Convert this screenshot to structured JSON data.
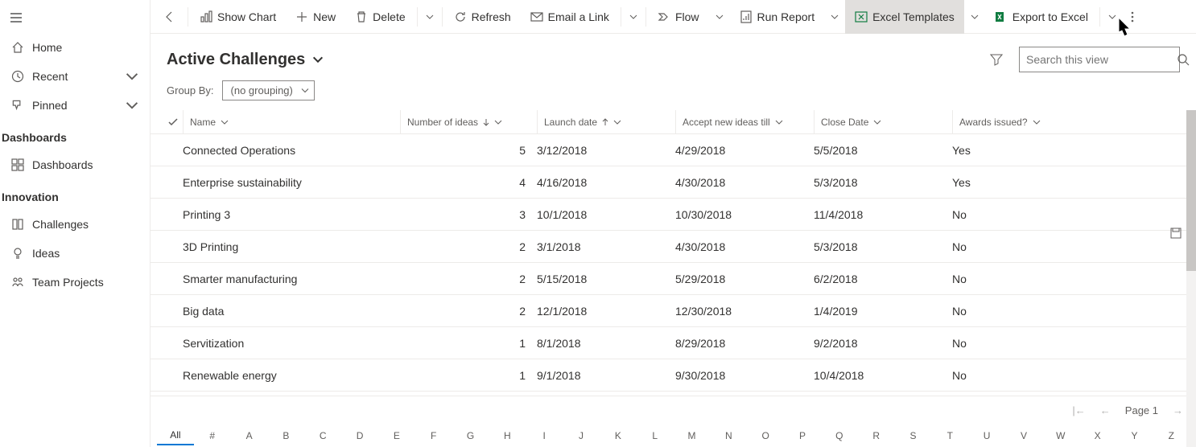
{
  "sidebar": {
    "home": "Home",
    "recent": "Recent",
    "pinned": "Pinned",
    "section_dashboards": "Dashboards",
    "item_dashboards": "Dashboards",
    "section_innovation": "Innovation",
    "item_challenges": "Challenges",
    "item_ideas": "Ideas",
    "item_teamprojects": "Team Projects"
  },
  "toolbar": {
    "show_chart": "Show Chart",
    "new": "New",
    "delete": "Delete",
    "refresh": "Refresh",
    "email_link": "Email a Link",
    "flow": "Flow",
    "run_report": "Run Report",
    "excel_templates": "Excel Templates",
    "export_excel": "Export to Excel"
  },
  "view": {
    "title": "Active Challenges",
    "groupby_label": "Group By:",
    "groupby_value": "(no grouping)",
    "search_placeholder": "Search this view"
  },
  "columns": {
    "name": "Name",
    "number_of_ideas": "Number of ideas",
    "launch_date": "Launch date",
    "accept_until": "Accept new ideas till",
    "close_date": "Close Date",
    "awards": "Awards issued?"
  },
  "rows": [
    {
      "name": "Connected Operations",
      "num": "5",
      "launch": "3/12/2018",
      "accept": "4/29/2018",
      "close": "5/5/2018",
      "awards": "Yes"
    },
    {
      "name": "Enterprise sustainability",
      "num": "4",
      "launch": "4/16/2018",
      "accept": "4/30/2018",
      "close": "5/3/2018",
      "awards": "Yes"
    },
    {
      "name": "Printing 3",
      "num": "3",
      "launch": "10/1/2018",
      "accept": "10/30/2018",
      "close": "11/4/2018",
      "awards": "No"
    },
    {
      "name": "3D Printing",
      "num": "2",
      "launch": "3/1/2018",
      "accept": "4/30/2018",
      "close": "5/3/2018",
      "awards": "No"
    },
    {
      "name": "Smarter manufacturing",
      "num": "2",
      "launch": "5/15/2018",
      "accept": "5/29/2018",
      "close": "6/2/2018",
      "awards": "No"
    },
    {
      "name": "Big data",
      "num": "2",
      "launch": "12/1/2018",
      "accept": "12/30/2018",
      "close": "1/4/2019",
      "awards": "No"
    },
    {
      "name": "Servitization",
      "num": "1",
      "launch": "8/1/2018",
      "accept": "8/29/2018",
      "close": "9/2/2018",
      "awards": "No"
    },
    {
      "name": "Renewable energy",
      "num": "1",
      "launch": "9/1/2018",
      "accept": "9/30/2018",
      "close": "10/4/2018",
      "awards": "No"
    }
  ],
  "footer": {
    "page_label": "Page 1"
  },
  "alpha": [
    "All",
    "#",
    "A",
    "B",
    "C",
    "D",
    "E",
    "F",
    "G",
    "H",
    "I",
    "J",
    "K",
    "L",
    "M",
    "N",
    "O",
    "P",
    "Q",
    "R",
    "S",
    "T",
    "U",
    "V",
    "W",
    "X",
    "Y",
    "Z"
  ]
}
